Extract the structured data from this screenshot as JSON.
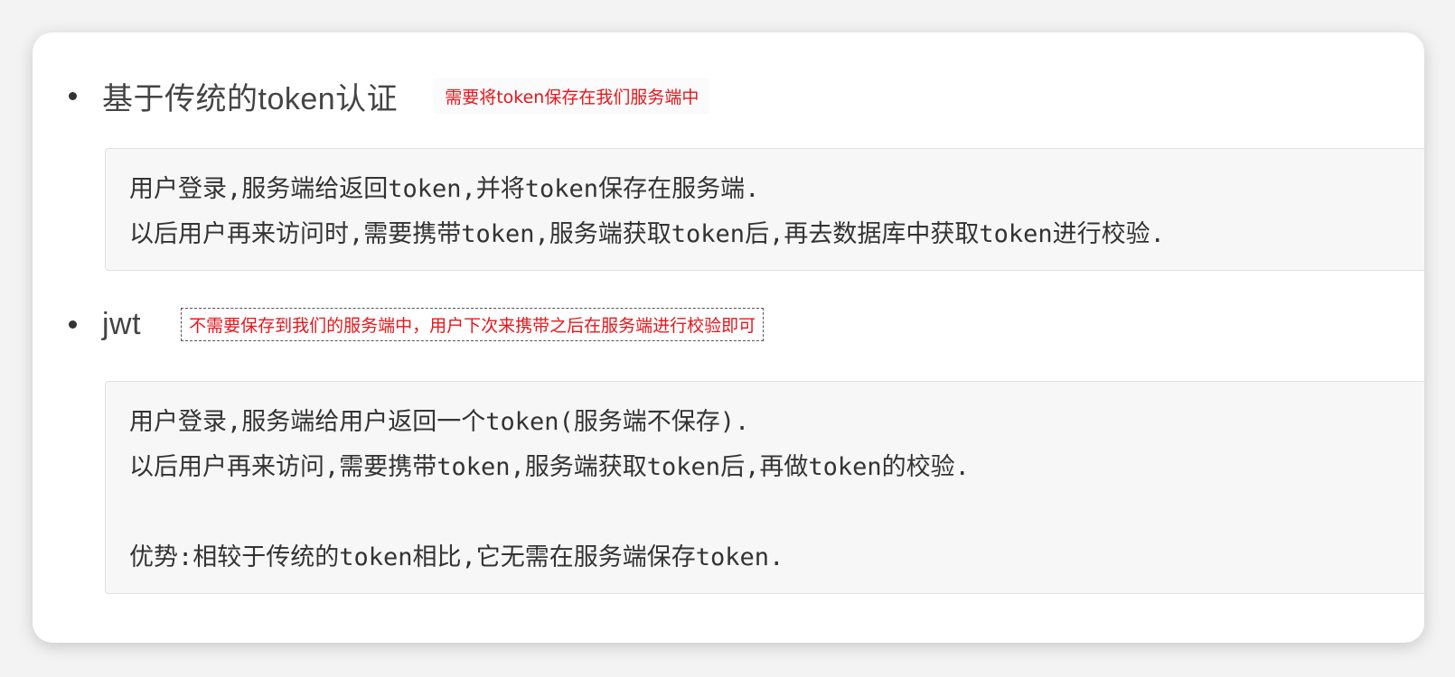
{
  "section1": {
    "title": "基于传统的token认证",
    "note": "需要将token保存在我们服务端中",
    "lines": [
      "用户登录,服务端给返回token,并将token保存在服务端.",
      "以后用户再来访问时,需要携带token,服务端获取token后,再去数据库中获取token进行校验."
    ]
  },
  "section2": {
    "title": "jwt",
    "note": "不需要保存到我们的服务端中，用户下次来携带之后在服务端进行校验即可",
    "lines": [
      "用户登录,服务端给用户返回一个token(服务端不保存).",
      "以后用户再来访问,需要携带token,服务端获取token后,再做token的校验.",
      "",
      "优势:相较于传统的token相比,它无需在服务端保存token."
    ]
  }
}
